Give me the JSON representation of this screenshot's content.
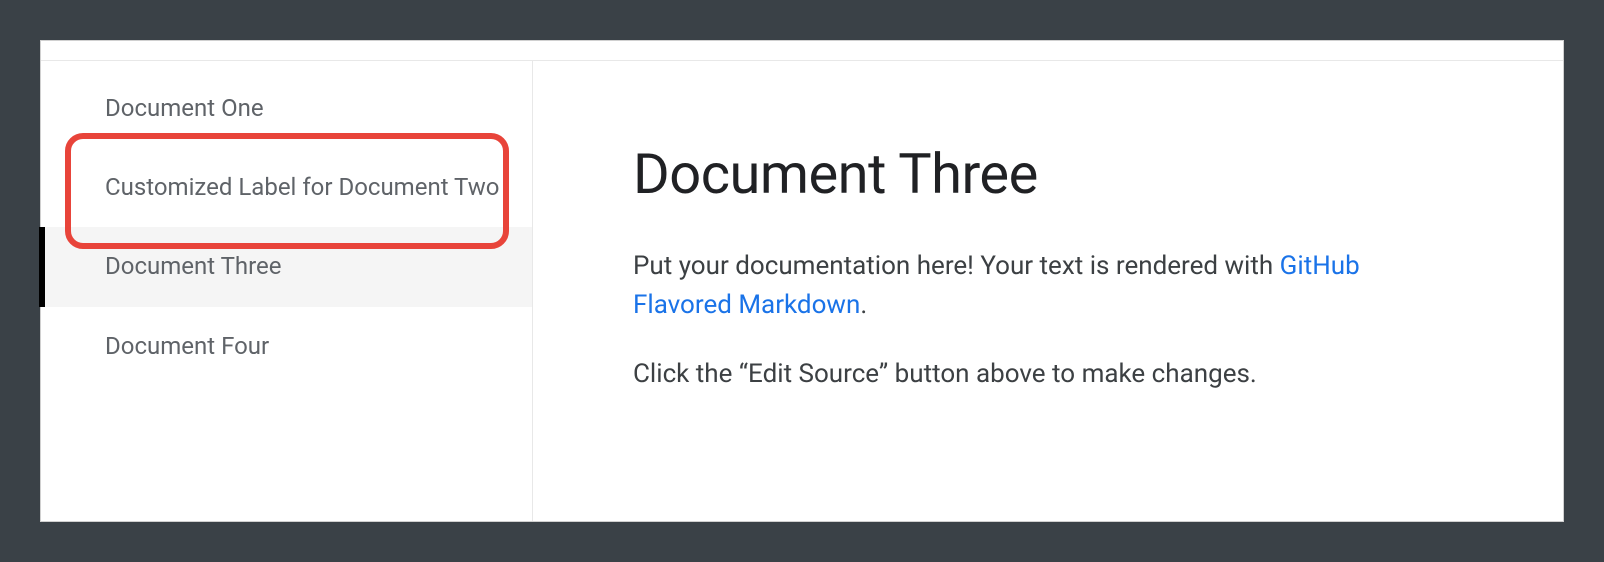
{
  "sidebar": {
    "items": [
      {
        "label": "Document One",
        "active": false
      },
      {
        "label": "Customized Label for Document Two",
        "active": false,
        "highlighted": true
      },
      {
        "label": "Document Three",
        "active": true
      },
      {
        "label": "Document Four",
        "active": false
      }
    ]
  },
  "main": {
    "title": "Document Three",
    "paragraph1_part1": "Put your documentation here! Your text is rendered with ",
    "paragraph1_link": "GitHub Flavored Markdown",
    "paragraph1_part2": ".",
    "paragraph2": "Click the “Edit Source” button above to make changes."
  },
  "colors": {
    "highlight": "#e8443a",
    "link": "#1a73e8",
    "text_primary": "#202124",
    "text_secondary": "#5f6368"
  }
}
